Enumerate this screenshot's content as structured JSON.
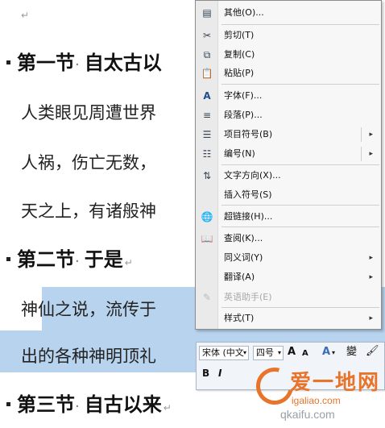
{
  "document": {
    "para_mark": "↵",
    "heading1": {
      "text": "第一节",
      "dot": "·",
      "rest": "自太古以"
    },
    "line1": "人类眼见周遭世界",
    "line2": "人祸，伤亡无数，",
    "line3": "天之上，有诸般神",
    "heading2": {
      "text": "第二节",
      "dot": "·",
      "rest": "于是",
      "ret": "↵"
    },
    "line4_pre": "神",
    "line4_sel": "仙之说，流传于",
    "line5": "出的各种神明顶礼",
    "heading3": {
      "text": "第三节",
      "dot": "·",
      "rest": "自古以来",
      "ret": "↵"
    }
  },
  "context_menu": {
    "items": [
      {
        "label": "其他(O)...",
        "icon": "other-icon",
        "glyph": "▤"
      },
      {
        "label": "剪切(T)",
        "icon": "scissors-icon",
        "glyph": "✂"
      },
      {
        "label": "复制(C)",
        "icon": "copy-icon",
        "glyph": "⧉"
      },
      {
        "label": "粘贴(P)",
        "icon": "paste-icon",
        "glyph": "📋"
      },
      {
        "label": "字体(F)...",
        "icon": "font-icon",
        "glyph": "A"
      },
      {
        "label": "段落(P)...",
        "icon": "paragraph-icon",
        "glyph": "≡"
      },
      {
        "label": "项目符号(B)",
        "icon": "bullets-icon",
        "glyph": "☰"
      },
      {
        "label": "编号(N)",
        "icon": "numbering-icon",
        "glyph": "☷"
      },
      {
        "label": "文字方向(X)...",
        "icon": "text-direction-icon",
        "glyph": "⇅"
      },
      {
        "label": "插入符号(S)",
        "icon": "",
        "glyph": ""
      },
      {
        "label": "超链接(H)...",
        "icon": "hyperlink-icon",
        "glyph": "🌐"
      },
      {
        "label": "查阅(K)...",
        "icon": "lookup-icon",
        "glyph": "📖"
      },
      {
        "label": "同义词(Y)",
        "icon": "",
        "glyph": ""
      },
      {
        "label": "翻译(A)",
        "icon": "",
        "glyph": ""
      },
      {
        "label": "英语助手(E)",
        "icon": "english-assistant-icon",
        "glyph": "✎"
      },
      {
        "label": "样式(T)",
        "icon": "",
        "glyph": ""
      }
    ],
    "submenu_arrow": "▸"
  },
  "mini_toolbar": {
    "font_name": "宋体 (中文",
    "font_size": "四号",
    "grow_font": "A",
    "shrink_font": "A",
    "styles": "A",
    "phonetic": "變",
    "format_painter": "🖌",
    "bold": "B",
    "italic": "I",
    "dropdown": "▾"
  },
  "watermark": {
    "main": "爱一地网",
    "url1": "igaliao.com",
    "url2": "qkaifu.com"
  }
}
